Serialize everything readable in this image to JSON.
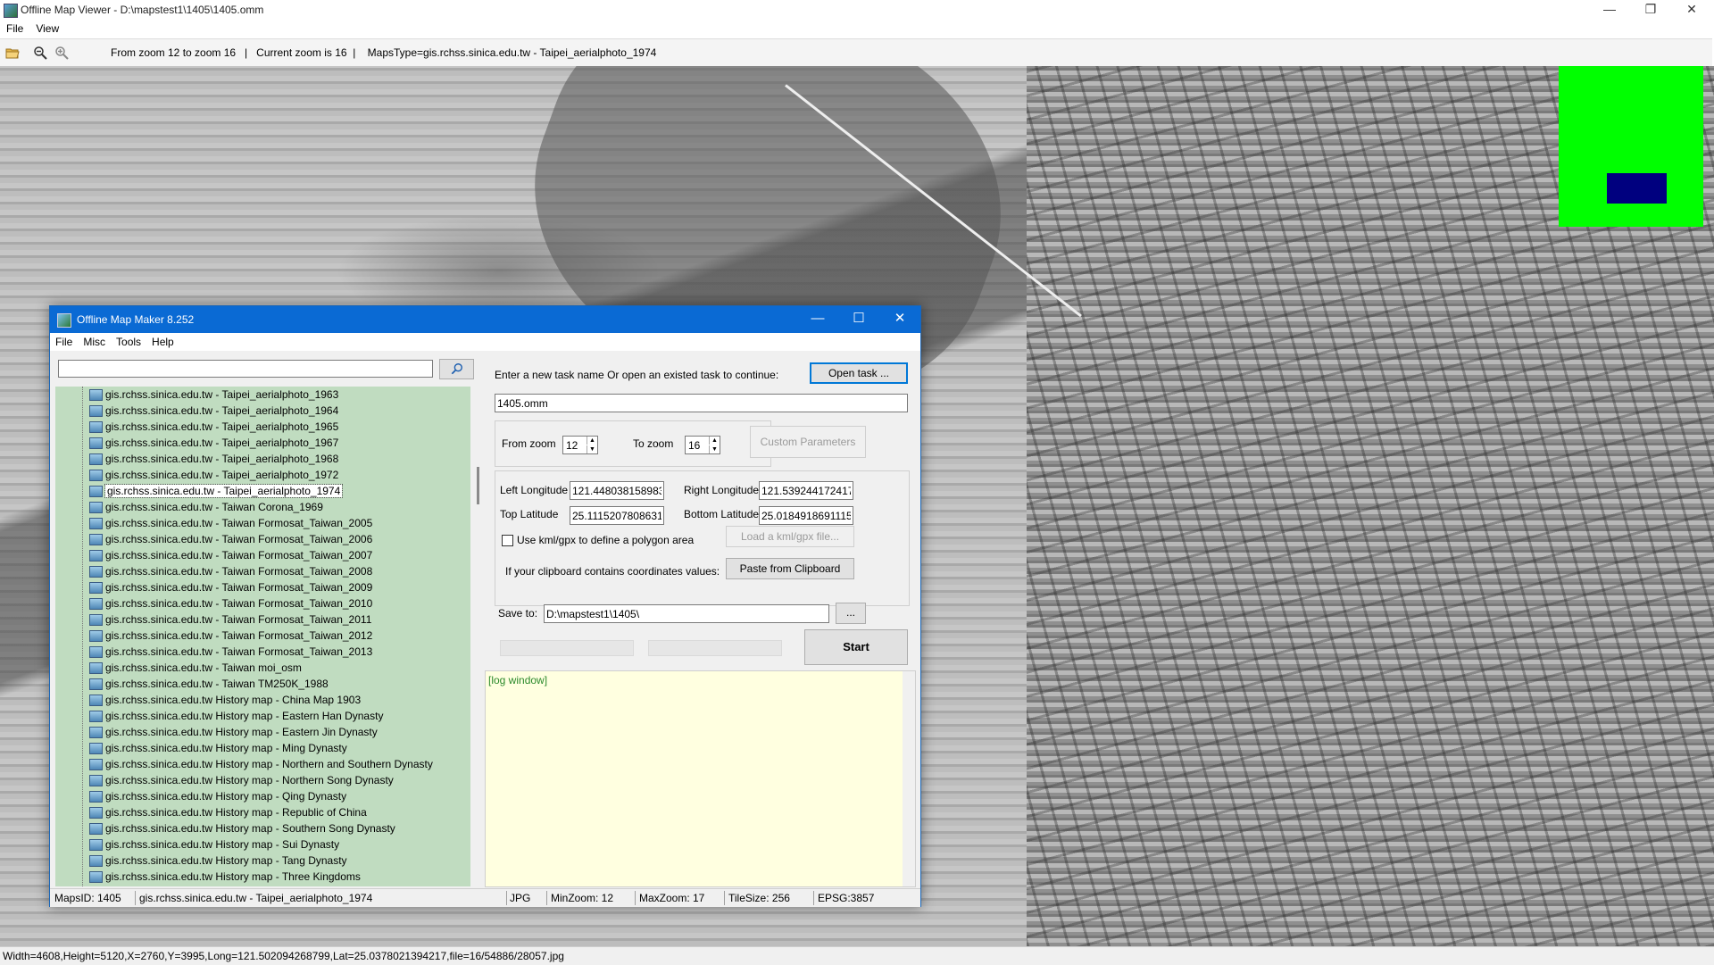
{
  "window": {
    "title": "Offline Map Viewer - D:\\mapstest1\\1405\\1405.omm",
    "menu": [
      "File",
      "View"
    ],
    "controls": {
      "minimize": "—",
      "maximize": "❐",
      "close": "✕"
    }
  },
  "toolbar": {
    "info": "From zoom 12 to zoom 16   |   Current zoom is 16  |    MapsType=gis.rchss.sinica.edu.tw - Taipei_aerialphoto_1974"
  },
  "status_bar": {
    "text": "Width=4608,Height=5120,X=2760,Y=3995,Long=121.502094268799,Lat=25.0378021394217,file=16/54886/28057.jpg"
  },
  "minimap": {
    "background": "#00ff00",
    "viewport_color": "#00007f"
  },
  "dialog": {
    "title": "Offline Map Maker 8.252",
    "controls": {
      "minimize": "—",
      "maximize": "☐",
      "close": "✕"
    },
    "menu": [
      "File",
      "Misc",
      "Tools",
      "Help"
    ],
    "search": {
      "value": "",
      "button_icon": "search-icon"
    },
    "map_list": [
      {
        "label": "gis.rchss.sinica.edu.tw - Taipei_aerialphoto_1963",
        "selected": false
      },
      {
        "label": "gis.rchss.sinica.edu.tw - Taipei_aerialphoto_1964",
        "selected": false
      },
      {
        "label": "gis.rchss.sinica.edu.tw - Taipei_aerialphoto_1965",
        "selected": false
      },
      {
        "label": "gis.rchss.sinica.edu.tw - Taipei_aerialphoto_1967",
        "selected": false
      },
      {
        "label": "gis.rchss.sinica.edu.tw - Taipei_aerialphoto_1968",
        "selected": false
      },
      {
        "label": "gis.rchss.sinica.edu.tw - Taipei_aerialphoto_1972",
        "selected": false
      },
      {
        "label": "gis.rchss.sinica.edu.tw - Taipei_aerialphoto_1974",
        "selected": true
      },
      {
        "label": "gis.rchss.sinica.edu.tw - Taiwan Corona_1969",
        "selected": false
      },
      {
        "label": "gis.rchss.sinica.edu.tw - Taiwan Formosat_Taiwan_2005",
        "selected": false
      },
      {
        "label": "gis.rchss.sinica.edu.tw - Taiwan Formosat_Taiwan_2006",
        "selected": false
      },
      {
        "label": "gis.rchss.sinica.edu.tw - Taiwan Formosat_Taiwan_2007",
        "selected": false
      },
      {
        "label": "gis.rchss.sinica.edu.tw - Taiwan Formosat_Taiwan_2008",
        "selected": false
      },
      {
        "label": "gis.rchss.sinica.edu.tw - Taiwan Formosat_Taiwan_2009",
        "selected": false
      },
      {
        "label": "gis.rchss.sinica.edu.tw - Taiwan Formosat_Taiwan_2010",
        "selected": false
      },
      {
        "label": "gis.rchss.sinica.edu.tw - Taiwan Formosat_Taiwan_2011",
        "selected": false
      },
      {
        "label": "gis.rchss.sinica.edu.tw - Taiwan Formosat_Taiwan_2012",
        "selected": false
      },
      {
        "label": "gis.rchss.sinica.edu.tw - Taiwan Formosat_Taiwan_2013",
        "selected": false
      },
      {
        "label": "gis.rchss.sinica.edu.tw - Taiwan moi_osm",
        "selected": false
      },
      {
        "label": "gis.rchss.sinica.edu.tw - Taiwan TM250K_1988",
        "selected": false
      },
      {
        "label": "gis.rchss.sinica.edu.tw History map - China Map 1903",
        "selected": false
      },
      {
        "label": "gis.rchss.sinica.edu.tw History map - Eastern Han Dynasty",
        "selected": false
      },
      {
        "label": "gis.rchss.sinica.edu.tw History map - Eastern Jin Dynasty",
        "selected": false
      },
      {
        "label": "gis.rchss.sinica.edu.tw History map - Ming Dynasty",
        "selected": false
      },
      {
        "label": "gis.rchss.sinica.edu.tw History map - Northern and Southern Dynasty",
        "selected": false
      },
      {
        "label": "gis.rchss.sinica.edu.tw History map - Northern Song Dynasty",
        "selected": false
      },
      {
        "label": "gis.rchss.sinica.edu.tw History map - Qing Dynasty",
        "selected": false
      },
      {
        "label": "gis.rchss.sinica.edu.tw History map - Republic of China",
        "selected": false
      },
      {
        "label": "gis.rchss.sinica.edu.tw History map - Southern Song Dynasty",
        "selected": false
      },
      {
        "label": "gis.rchss.sinica.edu.tw History map - Sui Dynasty",
        "selected": false
      },
      {
        "label": "gis.rchss.sinica.edu.tw History map - Tang Dynasty",
        "selected": false
      },
      {
        "label": "gis.rchss.sinica.edu.tw History map - Three Kingdoms",
        "selected": false
      }
    ],
    "task": {
      "prompt": "Enter a new task name Or open an existed task to continue:",
      "open_button": "Open task ...",
      "task_name": "1405.omm"
    },
    "zoom": {
      "from_label": "From zoom",
      "from_value": "12",
      "to_label": "To zoom",
      "to_value": "16",
      "custom_button": "Custom Parameters"
    },
    "coords": {
      "left_lon_label": "Left Longitude",
      "left_lon": "121.448038158983",
      "right_lon_label": "Right Longitude",
      "right_lon": "121.539244172417",
      "top_lat_label": "Top Latitude",
      "top_lat": "25.1115207808631",
      "bottom_lat_label": "Bottom Latitude",
      "bottom_lat": "25.0184918691115",
      "kml_checkbox_label": "Use kml/gpx to define a polygon area",
      "kml_checked": false,
      "load_kml_button": "Load a kml/gpx file...",
      "clipboard_label": "If your clipboard contains coordinates values:",
      "paste_button": "Paste from Clipboard"
    },
    "save": {
      "label": "Save to:",
      "path": "D:\\mapstest1\\1405\\",
      "browse_button": "..."
    },
    "progress": {
      "bar1": 0,
      "bar2": 0,
      "bar3": 0
    },
    "start_button": "Start",
    "log": {
      "text": "[log window]"
    },
    "status": {
      "maps_id": "MapsID: 1405",
      "map_name": "gis.rchss.sinica.edu.tw - Taipei_aerialphoto_1974",
      "format": "JPG",
      "min_zoom": "MinZoom: 12",
      "max_zoom": "MaxZoom: 17",
      "tile_size": "TileSize: 256",
      "epsg": "EPSG:3857"
    }
  }
}
